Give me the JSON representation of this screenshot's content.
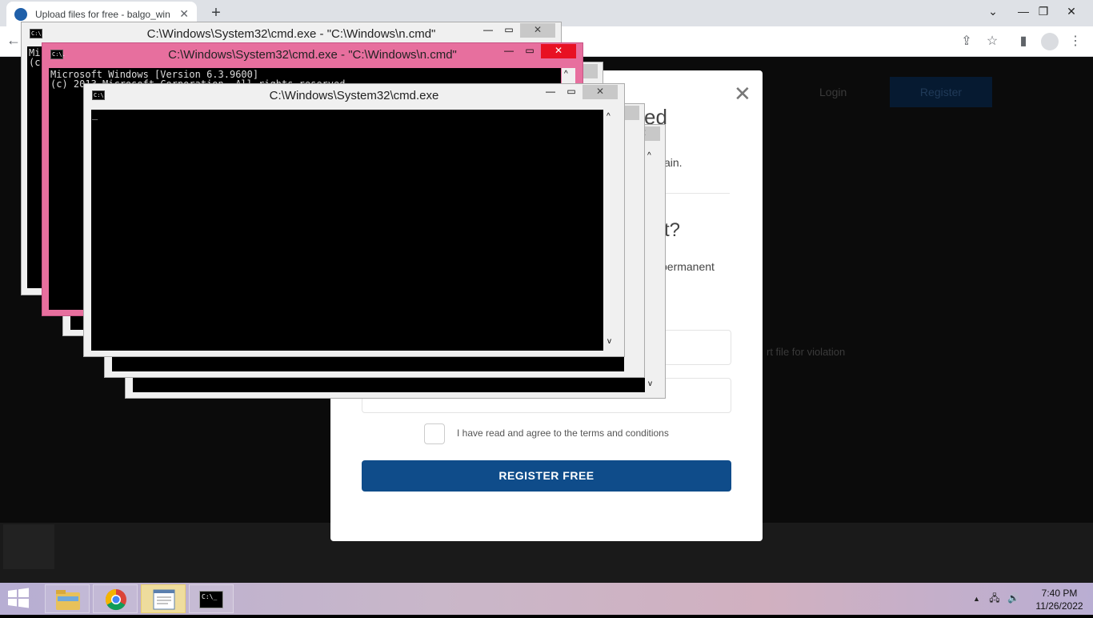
{
  "browser": {
    "tab_title": "Upload files for free - balgo_win",
    "tab_close": "✕",
    "new_tab": "+",
    "window_controls": {
      "minimize": "—",
      "restore": "❐",
      "close": "✕",
      "collapse": "⌄"
    },
    "back": "←"
  },
  "page": {
    "login": "Login",
    "register": "Register",
    "report_fragment": "rt file for violation"
  },
  "modal": {
    "close": "✕",
    "heading_fragment": "ed",
    "line1_fragment": "ain.",
    "question_fragment": "t?",
    "line2_fragment": "permanent",
    "agree_label": "I have read and agree to the terms and conditions",
    "register_button": "REGISTER FREE"
  },
  "consoles": [
    {
      "title": "C:\\Windows\\System32\\cmd.exe - \"C:\\Windows\\n.cmd\"",
      "lines": [
        "Mi",
        "(c"
      ]
    },
    {
      "title": "C:\\Windows\\System32\\cmd.exe - \"C:\\Windows\\n.cmd\"",
      "lines": [
        "Microsoft Windows [Version 6.3.9600]",
        "(c) 2013 Microsoft Corporation. All rights reserved."
      ]
    },
    {
      "title": "C:\\Windows\\System32\\cmd.exe",
      "lines": [
        "_"
      ]
    }
  ],
  "console_icon_text": "C:\\.",
  "console_controls": {
    "minimize": "—",
    "maximize": "▭",
    "close": "✕",
    "scroll_up": "^",
    "scroll_down": "v"
  },
  "taskbar": {
    "apps": [
      "file-explorer",
      "chrome",
      "notepad",
      "cmd"
    ],
    "cmd_icon_text": "C:\\_",
    "tray_arrow": "▲",
    "network_icon": "🖧",
    "volume_icon": "🔊",
    "time": "7:40 PM",
    "date": "11/26/2022"
  },
  "colors": {
    "register_button": "#0f4c8a",
    "pink_console": "#e76f9e",
    "close_red": "#e81123"
  }
}
